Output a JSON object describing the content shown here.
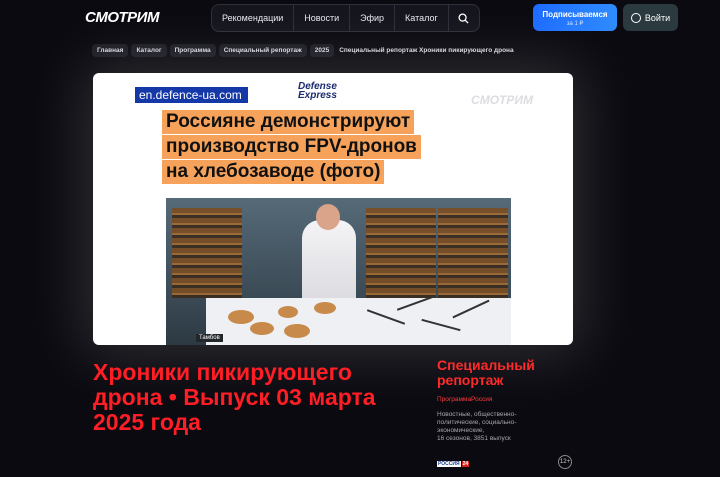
{
  "header": {
    "logo": "СМОТРИМ",
    "nav": [
      "Рекомендации",
      "Новости",
      "Эфир",
      "Каталог"
    ],
    "subscribe_label": "Подписываемся",
    "subscribe_price": "за 1 ₽",
    "login_label": "Войти"
  },
  "breadcrumbs": [
    "Главная",
    "Каталог",
    "Программа",
    "Специальный репортаж",
    "2025",
    "Специальный репортаж Хроники пикирующего дрона"
  ],
  "video": {
    "site_label": "en.defence-ua.com",
    "brand_line1": "Defense",
    "brand_line2": "Express",
    "watermark": "СМОТРИМ",
    "headline_lines": [
      "Россияне демонстрируют",
      "производство FPV-дронов",
      "на хлебозаводе (фото)"
    ],
    "location_tag": "Тамбов"
  },
  "episode": {
    "title": "Хроники пикирующего дрона • Выпуск 03 марта 2025 года"
  },
  "show": {
    "title_line1": "Специальный",
    "title_line2": "репортаж",
    "program_link": "ПрограммаРоссия",
    "description": "Новостные, общественно-политические, социально-экономические,",
    "stats": "16 сезонов, 3851 выпуск",
    "channel_a": "РОССИЯ",
    "channel_b": "24",
    "age_rating": "12+"
  }
}
